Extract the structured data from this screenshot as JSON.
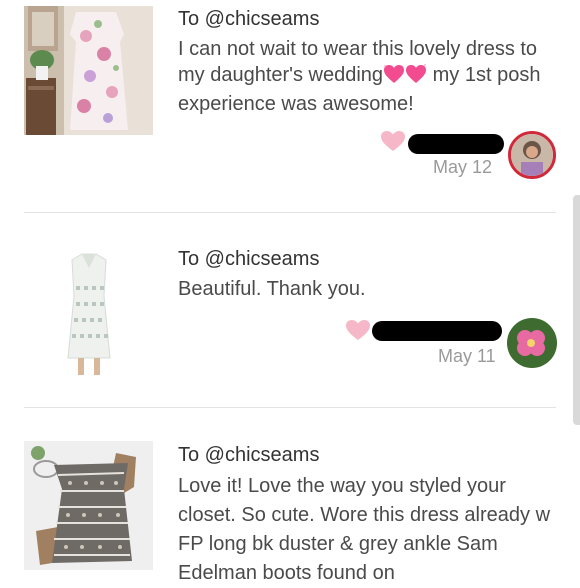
{
  "notes": [
    {
      "recipient": "To @chicseams",
      "message_part1": "I can not wait to wear this lovely dress to my daughter's wedding",
      "message_part2": " my 1st posh experience was awesome!",
      "date": "May 12",
      "liked": true
    },
    {
      "recipient": "To @chicseams",
      "message": "Beautiful. Thank you.",
      "date": "May 11",
      "liked": true
    },
    {
      "recipient": "To @chicseams",
      "message": "Love it! Love the way you styled your closet. So cute. Wore this dress already w FP long bk duster & grey ankle Sam Edelman boots found on"
    }
  ],
  "colors": {
    "heart": "#f6b8c8",
    "avatar_ring": "#d0293a",
    "divider": "#e3e3e3"
  },
  "icons": {
    "like": "heart-icon",
    "emoji": "sparkling-heart"
  }
}
